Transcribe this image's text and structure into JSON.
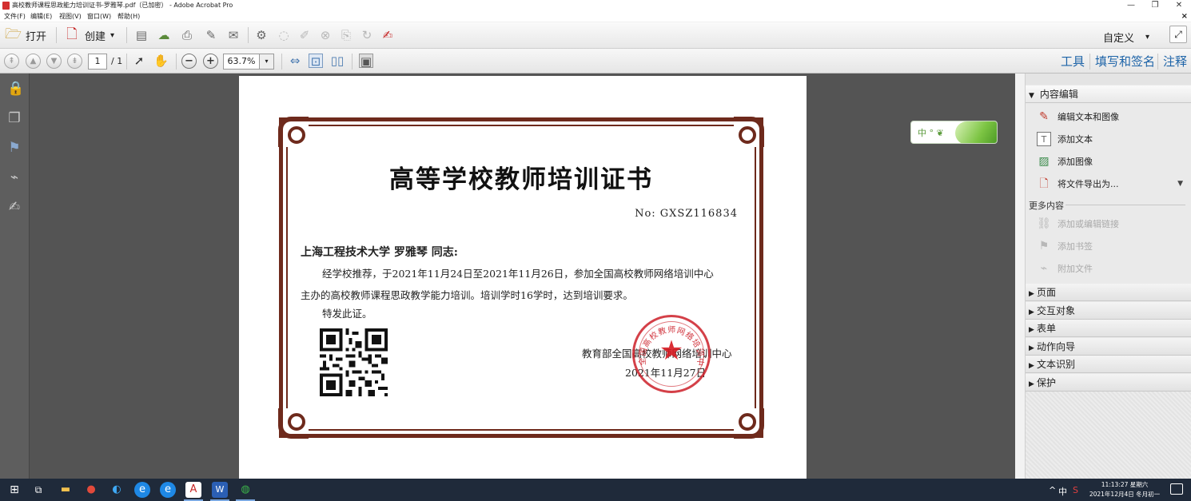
{
  "window": {
    "title": "高校教师课程思政能力培训证书-罗雅琴.pdf（已加密） - Adobe Acrobat Pro",
    "minimize": "—",
    "maximize": "❐",
    "close": "✕",
    "doc_close": "×"
  },
  "menu": [
    "文件(F)",
    "编辑(E)",
    "视图(V)",
    "窗口(W)",
    "帮助(H)"
  ],
  "toolbar": {
    "open_label": "打开",
    "create_label": "创建",
    "create_arrow": "▾",
    "customize_label": "自定义",
    "customize_arrow": "▾"
  },
  "nav": {
    "page_current": "1",
    "page_total": "/ 1",
    "zoom": "63.7%",
    "zoom_arrow": "▾"
  },
  "right_tabs": {
    "tools": "工具",
    "fill_sign": "填写和签名",
    "comment": "注释"
  },
  "certificate": {
    "title": "高等学校教师培训证书",
    "number": "No:  GXSZ116834",
    "recipient": "上海工程技术大学 罗雅琴 同志:",
    "line1": "经学校推荐，于2021年11月24日至2021年11月26日，参加全国高校教师网络培训中心",
    "line2": "主办的高校教师课程思政教学能力培训。培训学时16学时，达到培训要求。",
    "line3": "特发此证。",
    "issuer": "教育部全国高校教师网络培训中心",
    "date": "2021年11月27日",
    "seal_text": "全国高校教师网络培训中心"
  },
  "ime_widget": {
    "label": "中 ° ❦"
  },
  "panel": {
    "content_edit": "内容编辑",
    "content_items": [
      {
        "label": "编辑文本和图像",
        "icon": "edit-text-image-icon"
      },
      {
        "label": "添加文本",
        "icon": "add-text-icon"
      },
      {
        "label": "添加图像",
        "icon": "add-image-icon"
      },
      {
        "label": "将文件导出为...",
        "icon": "export-file-icon"
      }
    ],
    "more_content": "更多内容",
    "more_items": [
      {
        "label": "添加或编辑链接",
        "icon": "link-icon"
      },
      {
        "label": "添加书签",
        "icon": "bookmark-icon"
      },
      {
        "label": "附加文件",
        "icon": "attach-icon"
      }
    ],
    "sections": [
      "页面",
      "交互对象",
      "表单",
      "动作向导",
      "文本识别",
      "保护"
    ]
  },
  "taskbar": {
    "tray_chevron": "^",
    "ime": "中",
    "time": "11:13:27 星期六",
    "date": "2021年12月4日 冬月初一"
  },
  "colors": {
    "frame": "#6e2a1c",
    "seal": "#cc1e28",
    "link_tab": "#1e64a8",
    "doc_bg": "#545454"
  }
}
